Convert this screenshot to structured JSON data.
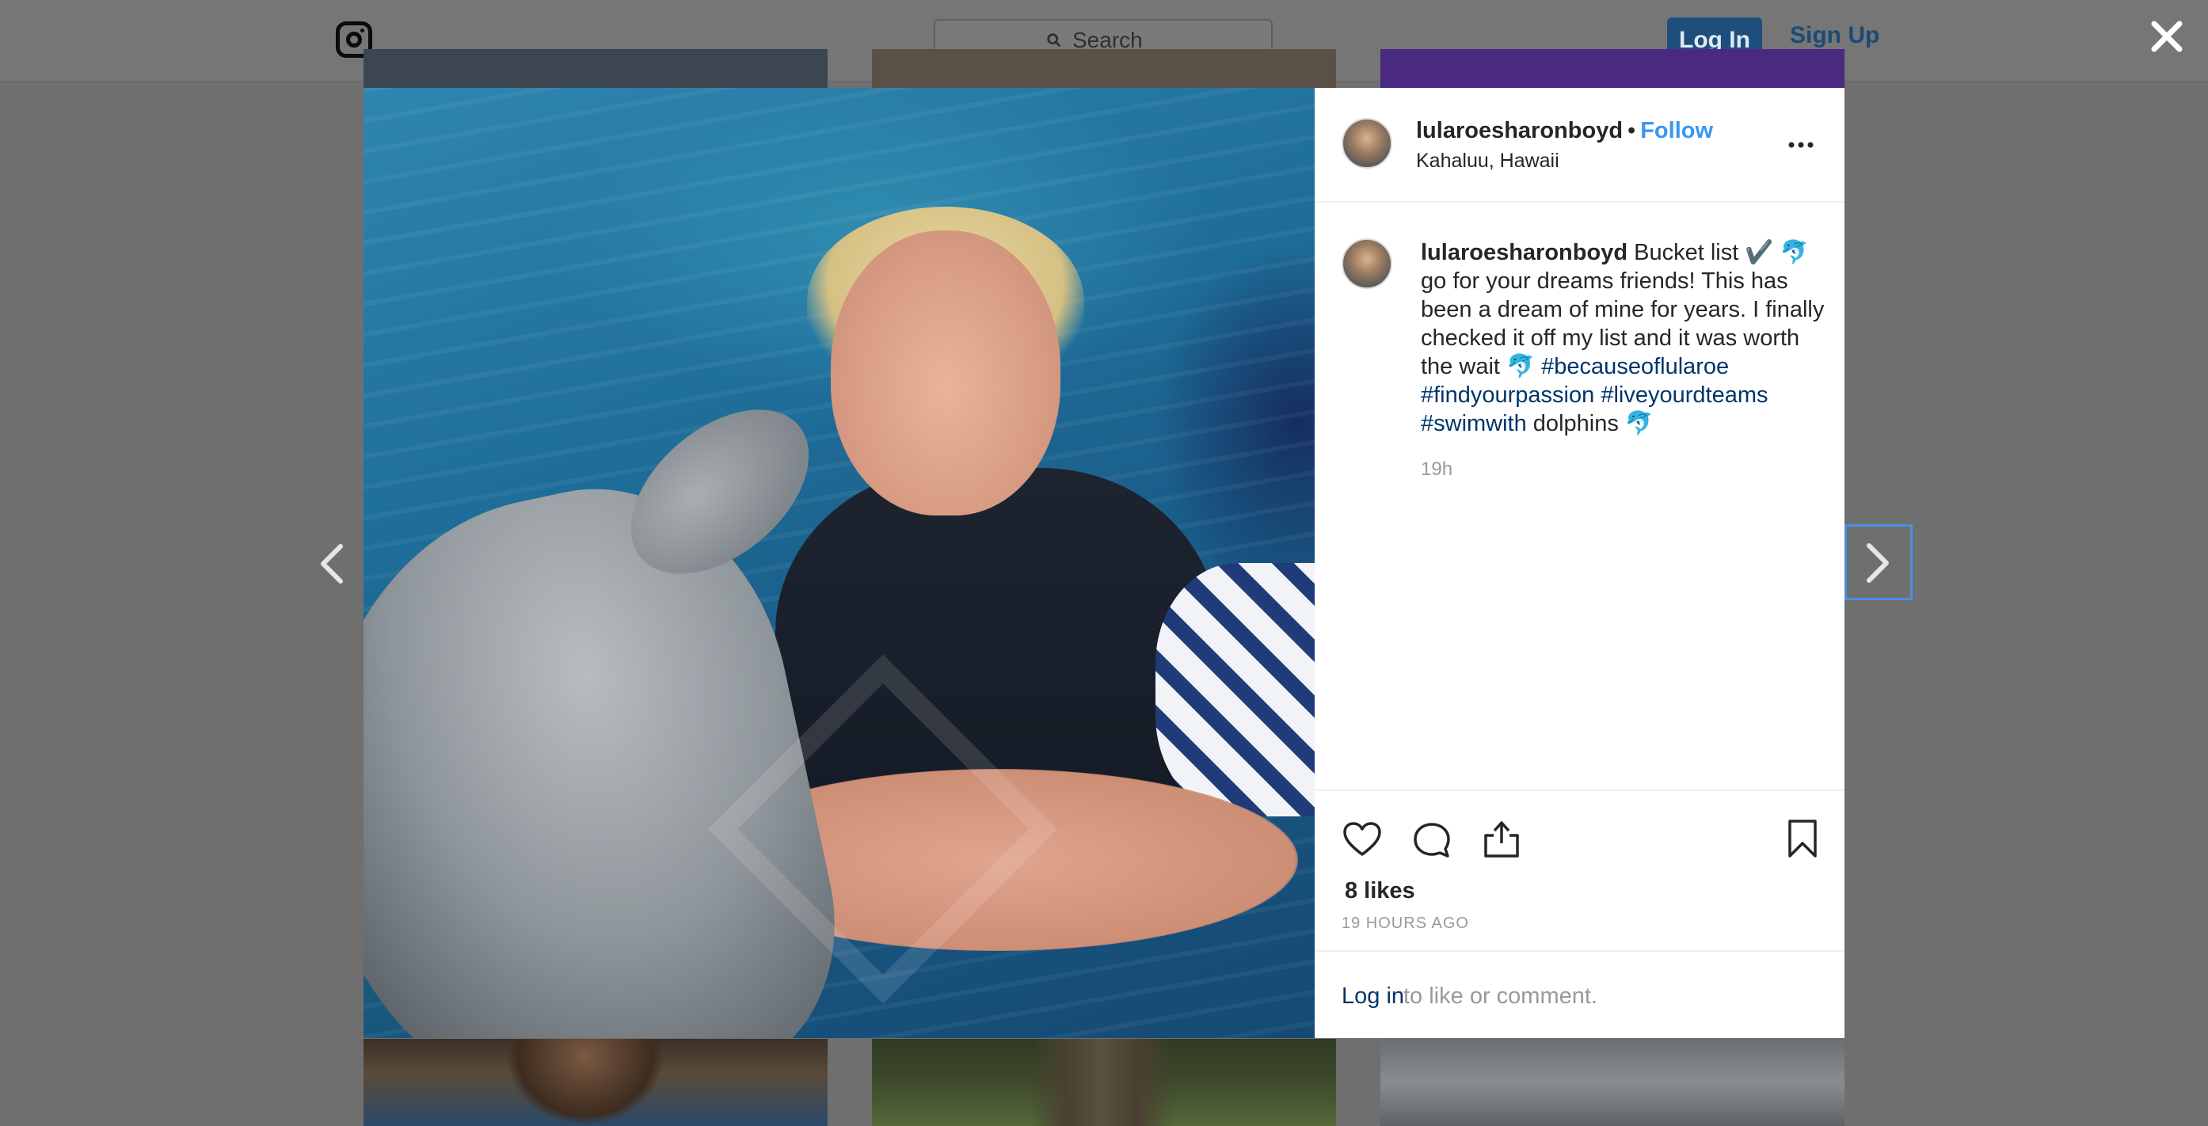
{
  "topbar": {
    "logo_icon": "instagram-logo-icon",
    "search": {
      "placeholder": "Search",
      "icon": "search-icon"
    },
    "login_label": "Log In",
    "signup_label": "Sign Up",
    "close_icon": "close-icon"
  },
  "post": {
    "username": "lularoesharonboyd",
    "separator": "•",
    "follow_label": "Follow",
    "location": "Kahaluu, Hawaii",
    "more_icon": "more-options-icon",
    "caption": {
      "username": "lularoesharonboyd",
      "text_1": " Bucket list ✔️ 🐬 go for your dreams friends! This has been a dream of mine for years. I finally checked it off my list and it was worth the wait 🐬 ",
      "hashtag_1": "#becauseoflularoe",
      "hashtag_2": "#findyourpassion",
      "hashtag_3": "#liveyourdteams",
      "hashtag_4": "#swimwith",
      "text_2": " dolphins 🐬",
      "time": "19h"
    },
    "actions": {
      "like_icon": "heart-icon",
      "comment_icon": "comment-icon",
      "share_icon": "share-icon",
      "save_icon": "bookmark-icon"
    },
    "likes": "8 likes",
    "posted": "19 HOURS AGO",
    "login_link": "Log in",
    "login_rest": "to like or comment."
  },
  "nav": {
    "prev_icon": "chevron-left-icon",
    "next_icon": "chevron-right-icon"
  },
  "colors": {
    "link_blue": "#3897f0",
    "hashtag_blue": "#003569",
    "text": "#262626",
    "muted": "#999999"
  }
}
